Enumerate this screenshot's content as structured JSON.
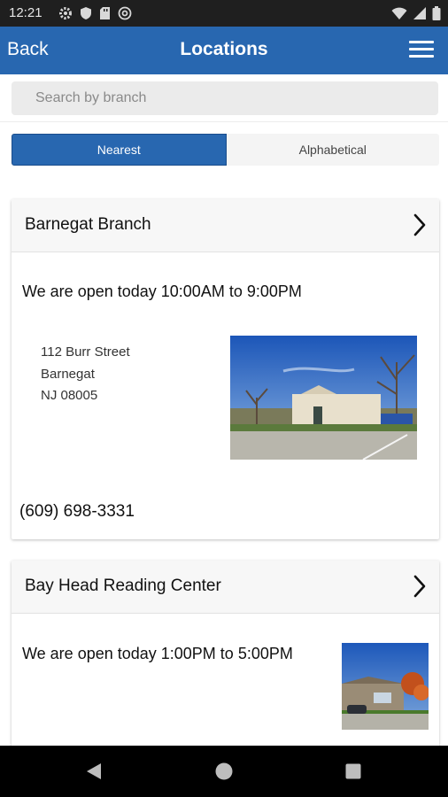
{
  "status_bar": {
    "time": "12:21",
    "icons": [
      "gear-icon",
      "shield-icon",
      "sd-card-icon",
      "at-sign-icon",
      "wifi-icon",
      "signal-icon",
      "battery-icon"
    ]
  },
  "app_bar": {
    "back_label": "Back",
    "title": "Locations",
    "menu_icon": "hamburger-menu-icon"
  },
  "search": {
    "placeholder": "Search by branch",
    "value": ""
  },
  "sort_toggle": {
    "options": [
      "Nearest",
      "Alphabetical"
    ],
    "selected": "Nearest"
  },
  "locations": [
    {
      "name": "Barnegat Branch",
      "hours": "We are open today 10:00AM to 9:00PM",
      "address": [
        "112 Burr Street",
        "Barnegat",
        "NJ 08005"
      ],
      "phone": "(609) 698-3331"
    },
    {
      "name": "Bay Head Reading Center",
      "hours": "We are open today 1:00PM to 5:00PM"
    }
  ],
  "nav_bar": {
    "buttons": [
      "back-triangle-icon",
      "home-circle-icon",
      "recents-square-icon"
    ]
  },
  "colors": {
    "primary": "#2867b0",
    "status_bar": "#1f1f1f",
    "nav_bar": "#000000"
  }
}
